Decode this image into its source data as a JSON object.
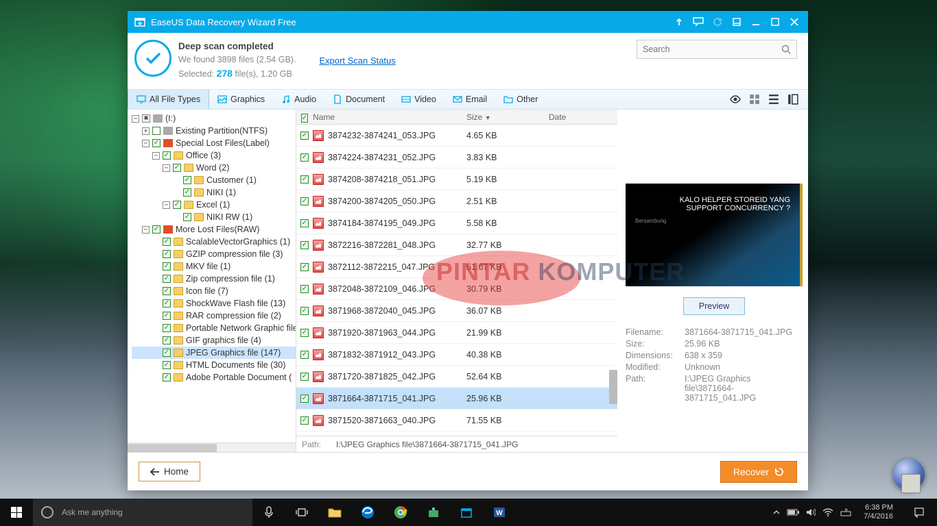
{
  "app": {
    "title": "EaseUS Data Recovery Wizard Free"
  },
  "header": {
    "scan_title": "Deep scan completed",
    "found_prefix": "We found ",
    "found_count": "3898",
    "found_mid": " files (",
    "found_size": "2.54 GB",
    "found_suffix": ").",
    "selected_prefix": "Selected: ",
    "selected_count": "278",
    "selected_mid": " file(s), ",
    "selected_size": "1.20 GB",
    "export_link": "Export Scan Status",
    "search_placeholder": "Search"
  },
  "filters": {
    "all": "All File Types",
    "graphics": "Graphics",
    "audio": "Audio",
    "document": "Document",
    "video": "Video",
    "email": "Email",
    "other": "Other"
  },
  "tree": {
    "root": "(I:)",
    "existing": "Existing Partition(NTFS)",
    "special": "Special Lost Files(Label)",
    "office": "Office (3)",
    "word": "Word (2)",
    "customer": "Customer (1)",
    "niki": "NIKI (1)",
    "excel": "Excel (1)",
    "nikirw": "NIKI RW (1)",
    "more": "More Lost Files(RAW)",
    "svg": "ScalableVectorGraphics (1)",
    "gzip": "GZIP compression file (3)",
    "mkv": "MKV file (1)",
    "zip": "Zip compression file (1)",
    "icon": "Icon file (7)",
    "swf": "ShockWave Flash file (13)",
    "rar": "RAR compression file (2)",
    "png": "Portable Network Graphic file",
    "gif": "GIF graphics file (4)",
    "jpeg": "JPEG Graphics file (147)",
    "html": "HTML Documents file (30)",
    "pdf": "Adobe Portable Document ("
  },
  "table": {
    "head_name": "Name",
    "head_size": "Size",
    "head_date": "Date",
    "rows": [
      {
        "name": "3874232-3874241_053.JPG",
        "size": "4.65 KB"
      },
      {
        "name": "3874224-3874231_052.JPG",
        "size": "3.83 KB"
      },
      {
        "name": "3874208-3874218_051.JPG",
        "size": "5.19 KB"
      },
      {
        "name": "3874200-3874205_050.JPG",
        "size": "2.51 KB"
      },
      {
        "name": "3874184-3874195_049.JPG",
        "size": "5.58 KB"
      },
      {
        "name": "3872216-3872281_048.JPG",
        "size": "32.77 KB"
      },
      {
        "name": "3872112-3872215_047.JPG",
        "size": "51.67 KB"
      },
      {
        "name": "3872048-3872109_046.JPG",
        "size": "30.79 KB"
      },
      {
        "name": "3871968-3872040_045.JPG",
        "size": "36.07 KB"
      },
      {
        "name": "3871920-3871963_044.JPG",
        "size": "21.99 KB"
      },
      {
        "name": "3871832-3871912_043.JPG",
        "size": "40.38 KB"
      },
      {
        "name": "3871720-3871825_042.JPG",
        "size": "52.64 KB"
      },
      {
        "name": "3871664-3871715_041.JPG",
        "size": "25.96 KB"
      },
      {
        "name": "3871520-3871663_040.JPG",
        "size": "71.55 KB"
      }
    ],
    "selected_index": 12,
    "path_label": "Path:",
    "path_value": "I:\\JPEG Graphics file\\3871664-3871715_041.JPG"
  },
  "preview": {
    "img_line1": "KALO HELPER STOREID YANG",
    "img_line2": "SUPPORT CONCURRENCY ?",
    "img_line3": "Bersambung",
    "button": "Preview",
    "filename_l": "Filename:",
    "filename_v": "3871664-3871715_041.JPG",
    "size_l": "Size:",
    "size_v": "25.96 KB",
    "dim_l": "Dimensions:",
    "dim_v": "638 x 359",
    "mod_l": "Modified:",
    "mod_v": "Unknown",
    "path_l": "Path:",
    "path_v": "I:\\JPEG Graphics file\\3871664-3871715_041.JPG"
  },
  "footer": {
    "home": "Home",
    "recover": "Recover"
  },
  "taskbar": {
    "search": "Ask me anything",
    "time": "6:38 PM",
    "date": "7/4/2016"
  },
  "watermark": {
    "p1": "PINTAR",
    "p2": "KOMPUTER"
  }
}
